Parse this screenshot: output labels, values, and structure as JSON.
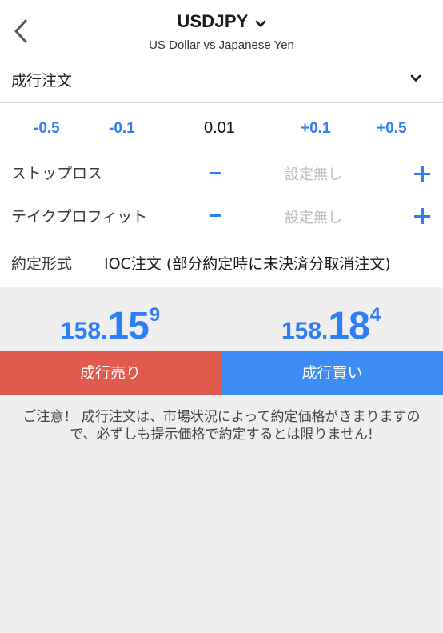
{
  "header": {
    "title": "USDJPY",
    "subtitle": "US Dollar vs Japanese Yen"
  },
  "order_type": {
    "selected": "成行注文"
  },
  "lot": {
    "minus_large": "-0.5",
    "minus_small": "-0.1",
    "value": "0.01",
    "plus_small": "+0.1",
    "plus_large": "+0.5"
  },
  "stop_loss": {
    "label": "ストップロス",
    "placeholder": "設定無し"
  },
  "take_profit": {
    "label": "テイクプロフィット",
    "placeholder": "設定無し"
  },
  "execution": {
    "label": "約定形式",
    "value": "IOC注文 (部分約定時に未決済分取消注文)"
  },
  "prices": {
    "sell": {
      "prefix": "158.",
      "big": "15",
      "sup": "9"
    },
    "buy": {
      "prefix": "158.",
      "big": "18",
      "sup": "4"
    }
  },
  "buttons": {
    "sell_label": "成行売り",
    "buy_label": "成行買い"
  },
  "notice": "ご注意！ 成行注文は、市場状況によって約定価格がきまりますので、必ずしも提示価格で約定するとは限りません!",
  "colors": {
    "accent_blue": "#2f7ef5",
    "sell_red": "#e05a4e",
    "buy_blue": "#3c8cf3"
  },
  "icons": {
    "back": "chevron-left-icon",
    "title_dropdown": "chevron-down-icon",
    "order_dropdown": "chevron-down-icon",
    "add": "plus-icon",
    "subtract": "minus-icon"
  }
}
